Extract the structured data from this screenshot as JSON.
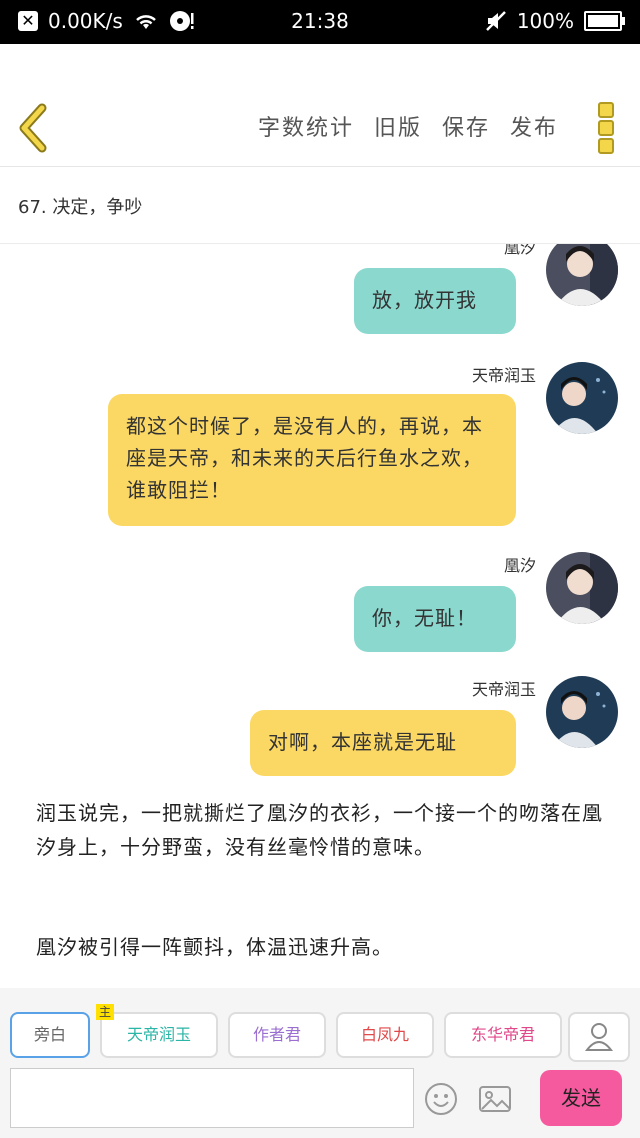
{
  "status_bar": {
    "speed": "0.00K/s",
    "time": "21:38",
    "battery": "100%"
  },
  "toolbar": {
    "word_count": "字数统计",
    "old_version": "旧版",
    "save": "保存",
    "publish": "发布"
  },
  "chapter": {
    "title": "67. 决定，争吵"
  },
  "messages": [
    {
      "name": "凰汐",
      "text": "放，放开我",
      "color": "#8bd8cf"
    },
    {
      "name": "天帝润玉",
      "text": "都这个时候了，是没有人的，再说，本座是天帝，和未来的天后行鱼水之欢，谁敢阻拦！",
      "color": "#fbd864"
    },
    {
      "name": "凰汐",
      "text": "你，无耻！",
      "color": "#8bd8cf"
    },
    {
      "name": "天帝润玉",
      "text": "对啊，本座就是无耻",
      "color": "#fbd864"
    }
  ],
  "narration": [
    "润玉说完，一把就撕烂了凰汐的衣衫，一个接一个的吻落在凰汐身上，十分野蛮，没有丝毫怜惜的意味。",
    "凰汐被引得一阵颤抖，体温迅速升高。"
  ],
  "roles": [
    {
      "label": "旁白",
      "color": "#666666"
    },
    {
      "label": "天帝润玉",
      "color": "#2bb5a6",
      "tag": "主"
    },
    {
      "label": "作者君",
      "color": "#9b6fd1"
    },
    {
      "label": "白凤九",
      "color": "#e0484a"
    },
    {
      "label": "东华帝君",
      "color": "#e0488a"
    }
  ],
  "send_label": "发送"
}
